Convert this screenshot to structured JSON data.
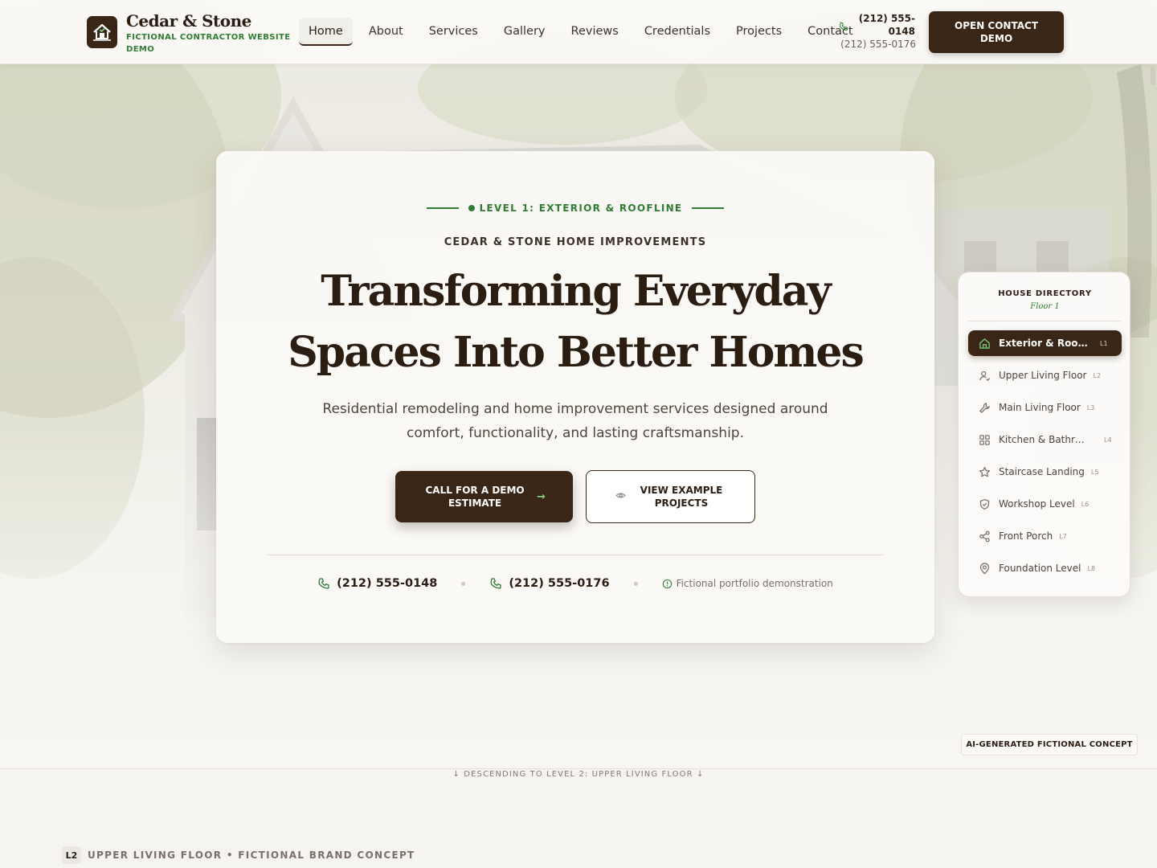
{
  "header": {
    "brand_name": "Cedar & Stone",
    "brand_tagline": "FICTIONAL CONTRACTOR WEBSITE DEMO",
    "logo_icon": "house-icon",
    "nav": [
      {
        "label": "Home",
        "active": true
      },
      {
        "label": "About"
      },
      {
        "label": "Services"
      },
      {
        "label": "Gallery"
      },
      {
        "label": "Reviews"
      },
      {
        "label": "Credentials"
      },
      {
        "label": "Projects"
      },
      {
        "label": "Contact"
      }
    ],
    "phone_primary": "(212) 555-0148",
    "phone_secondary": "(212) 555-0176",
    "cta_label": "OPEN CONTACT DEMO"
  },
  "hero": {
    "eyebrow": "LEVEL 1: EXTERIOR & ROOFLINE",
    "company": "CEDAR & STONE HOME IMPROVEMENTS",
    "headline": "Transforming Everyday Spaces Into Better Homes",
    "subcopy": "Residential remodeling and home improvement services designed around comfort, functionality, and lasting craftsmanship.",
    "primary_button": "CALL FOR A DEMO ESTIMATE",
    "secondary_button": "VIEW EXAMPLE PROJECTS",
    "phone_1": "(212) 555-0148",
    "phone_2": "(212) 555-0176",
    "note": "Fictional portfolio demonstration"
  },
  "directory": {
    "title": "HOUSE DIRECTORY",
    "floor": "Floor 1",
    "items": [
      {
        "label": "Exterior & Roofline",
        "level": "L1",
        "icon": "home-icon",
        "active": true
      },
      {
        "label": "Upper Living Floor",
        "level": "L2",
        "icon": "user-icon"
      },
      {
        "label": "Main Living Floor",
        "level": "L3",
        "icon": "wrench-icon"
      },
      {
        "label": "Kitchen & Bathrooms",
        "level": "L4",
        "icon": "grid-icon"
      },
      {
        "label": "Staircase Landing",
        "level": "L5",
        "icon": "star-icon"
      },
      {
        "label": "Workshop Level",
        "level": "L6",
        "icon": "shield-icon"
      },
      {
        "label": "Front Porch",
        "level": "L7",
        "icon": "share-icon"
      },
      {
        "label": "Foundation Level",
        "level": "L8",
        "icon": "map-pin-icon"
      }
    ]
  },
  "footer": {
    "ai_badge": "AI-GENERATED FICTIONAL CONCEPT",
    "descending": "↓ DESCENDING TO LEVEL 2: UPPER LIVING FLOOR ↓",
    "next_level_badge": "L2",
    "next_level_label": "UPPER LIVING FLOOR • FICTIONAL BRAND CONCEPT"
  },
  "colors": {
    "brand_dark": "#3a2616",
    "accent_green": "#2f7d32",
    "background": "#f5f4f0"
  }
}
